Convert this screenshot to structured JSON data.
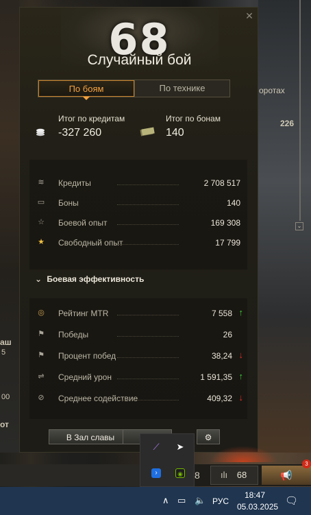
{
  "background": {
    "right_label": "оротах",
    "right_value": "226",
    "left_fragments": [
      "аш",
      "5",
      "00",
      "от"
    ]
  },
  "result": {
    "battle_count": "68",
    "mode": "Случайный бой",
    "close_icon": "close-icon"
  },
  "tabs": [
    {
      "label": "По боям",
      "active": true
    },
    {
      "label": "По технике",
      "active": false
    }
  ],
  "totals": {
    "credits_label": "Итог по кредитам",
    "credits_value": "-327 260",
    "bonds_label": "Итог по бонам",
    "bonds_value": "140"
  },
  "resources": [
    {
      "icon": "credits-icon",
      "glyph": "≋",
      "label": "Кредиты",
      "value": "2 708 517"
    },
    {
      "icon": "bonds-icon",
      "glyph": "▭",
      "label": "Боны",
      "value": "140"
    },
    {
      "icon": "xp-star-icon",
      "glyph": "☆",
      "label": "Боевой опыт",
      "value": "169 308"
    },
    {
      "icon": "free-xp-star-icon",
      "glyph": "★",
      "label": "Свободный опыт",
      "value": "17 799"
    }
  ],
  "efficiency": {
    "section_title": "Боевая эффективность",
    "rows": [
      {
        "icon": "mtr-rating-icon",
        "glyph": "◎",
        "label": "Рейтинг MTR",
        "value": "7 558",
        "trend": "up"
      },
      {
        "icon": "victory-flag-icon",
        "glyph": "⚑",
        "label": "Победы",
        "value": "26",
        "trend": ""
      },
      {
        "icon": "win-rate-flag-icon",
        "glyph": "⚑",
        "label": "Процент побед",
        "value": "38,24",
        "trend": "down"
      },
      {
        "icon": "damage-icon",
        "glyph": "⇌",
        "label": "Средний урон",
        "value": "1 591,35",
        "trend": "up"
      },
      {
        "icon": "assist-icon",
        "glyph": "⊘",
        "label": "Среднее содействие",
        "value": "409,32",
        "trend": "down"
      }
    ]
  },
  "buttons": {
    "hall_of_fame": "В Зал славы",
    "settings_icon": "gear-icon"
  },
  "bottom_bar": {
    "left_value": "8",
    "stats_value": "68",
    "notification_count": "3"
  },
  "tray": {
    "icons": [
      "feather-app-icon",
      "telegram-icon",
      "arrow-app-icon",
      "nvidia-icon"
    ]
  },
  "taskbar": {
    "language": "РУС",
    "time": "18:47",
    "date": "05.03.2025"
  },
  "colors": {
    "accent_orange": "#f4a341",
    "trend_up": "#3fcf3a",
    "trend_down": "#e0302a"
  }
}
